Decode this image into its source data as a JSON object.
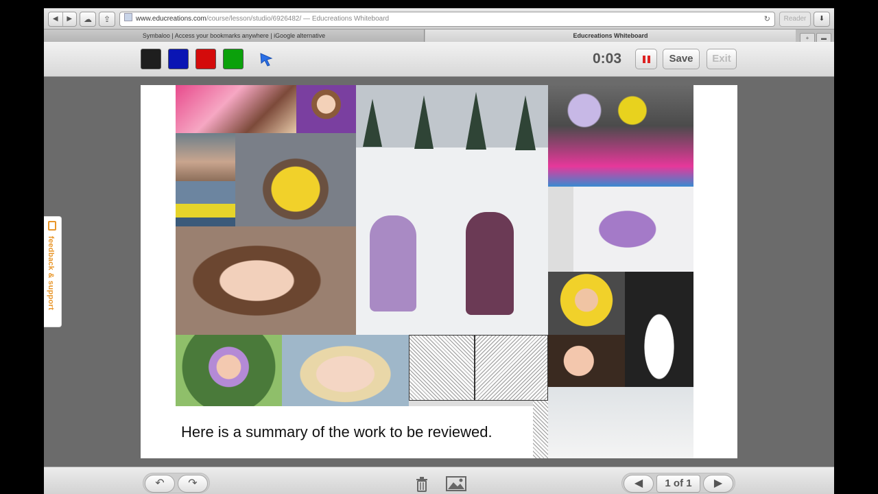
{
  "browser": {
    "url_host": "www.educreations.com",
    "url_path": "/course/lesson/studio/6926482/",
    "url_title_suffix": " — Educreations Whiteboard",
    "reader_label": "Reader",
    "tabs": [
      {
        "label": "Symbaloo | Access your bookmarks anywhere | iGoogle alternative"
      },
      {
        "label": "Educreations Whiteboard"
      }
    ]
  },
  "toolbar": {
    "colors": [
      {
        "name": "black",
        "hex": "#1e1e1e"
      },
      {
        "name": "blue",
        "hex": "#0a15b4"
      },
      {
        "name": "red",
        "hex": "#d40b0b"
      },
      {
        "name": "green",
        "hex": "#0ba10b"
      }
    ],
    "pointer_color": "#2a6fe6",
    "timer": "0:03",
    "save_label": "Save",
    "exit_label": "Exit"
  },
  "slide": {
    "caption": "Here is a summary of the work to be reviewed."
  },
  "feedback": {
    "label": "feedback & support"
  },
  "pager": {
    "label": "1 of 1"
  }
}
